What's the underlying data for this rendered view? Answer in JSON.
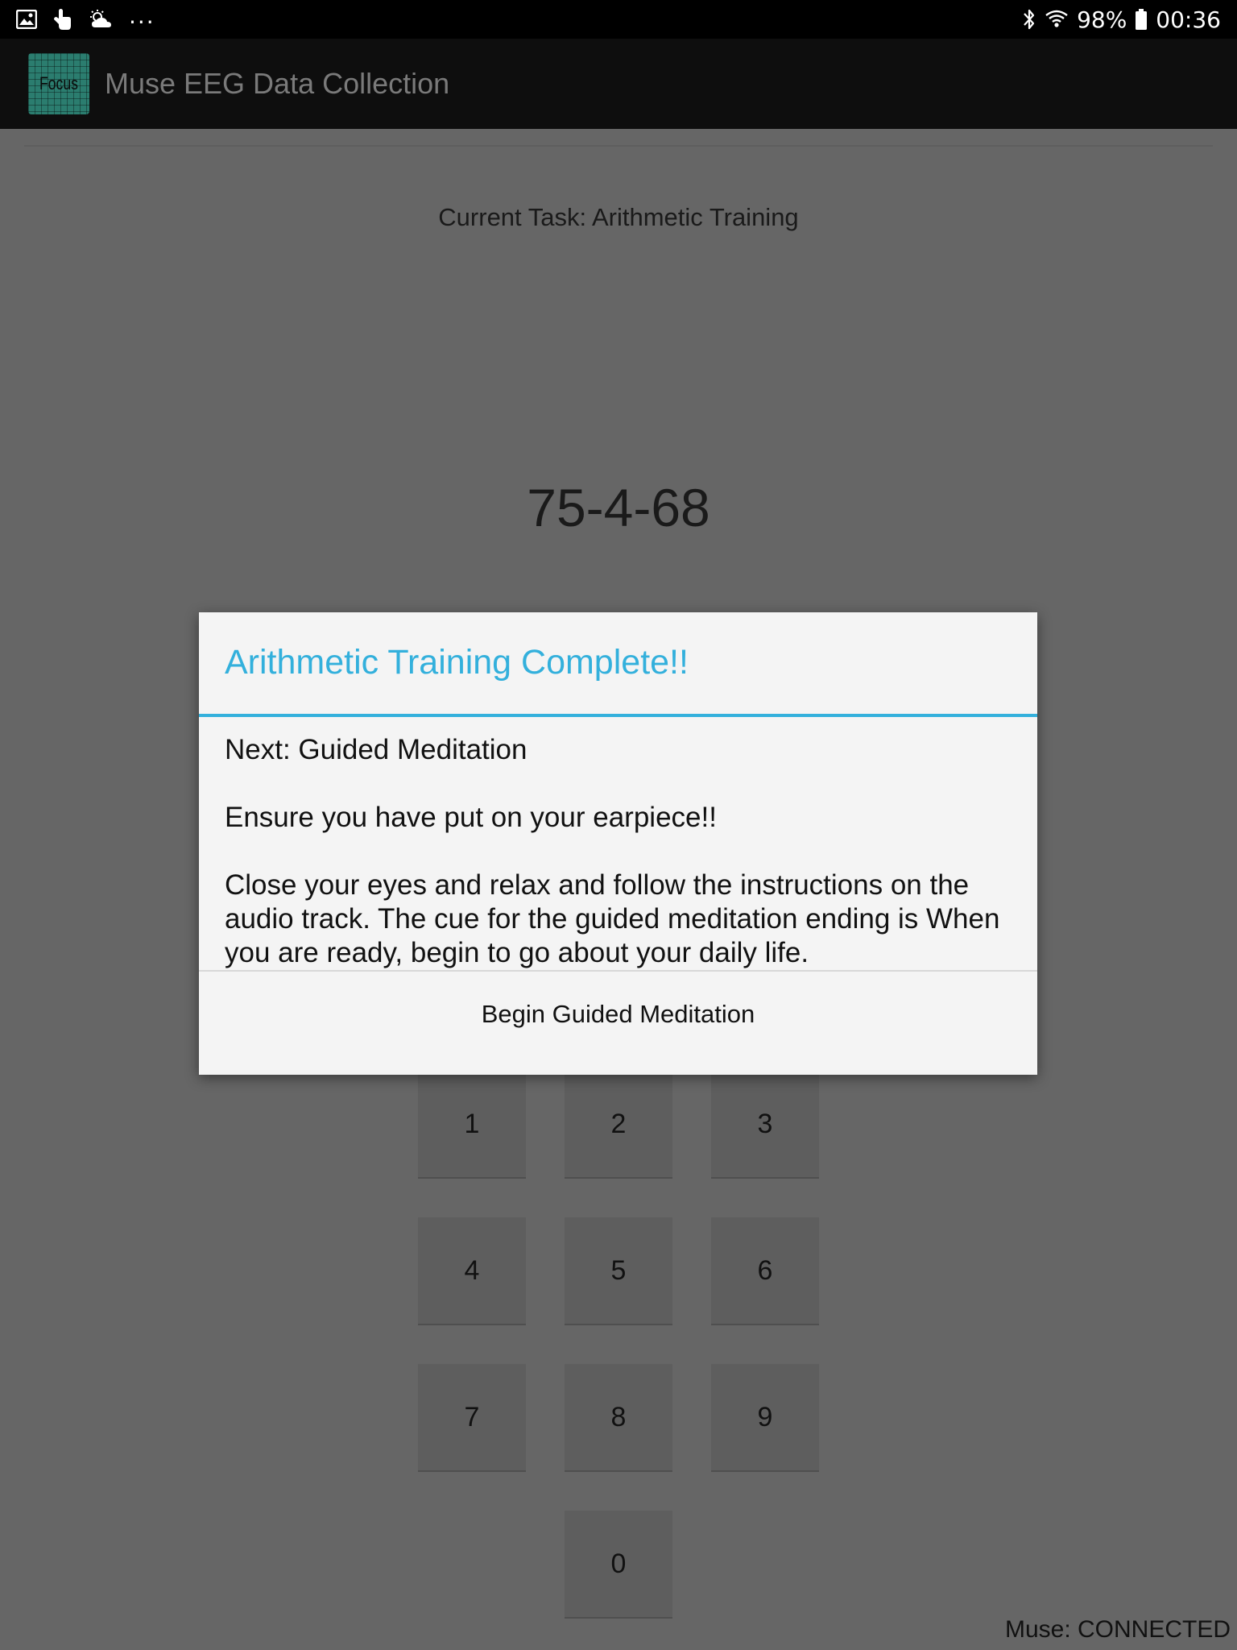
{
  "status_bar": {
    "battery": "98%",
    "time": "00:36",
    "more": "...",
    "icons": [
      "gallery-icon",
      "touch-icon",
      "weather-icon",
      "bluetooth-icon",
      "wifi-icon",
      "battery-icon"
    ]
  },
  "app_bar": {
    "logo_text": "Focus",
    "title": "Muse EEG Data Collection"
  },
  "main": {
    "current_task": "Current Task: Arithmetic Training",
    "problem": "75-4-68",
    "keypad": [
      "1",
      "2",
      "3",
      "4",
      "5",
      "6",
      "7",
      "8",
      "9",
      "0"
    ],
    "muse_status": "Muse: CONNECTED"
  },
  "dialog": {
    "title": "Arithmetic Training Complete!!",
    "next": "Next: Guided Meditation",
    "earpiece": "Ensure you have put on your earpiece!!",
    "instructions": "Close your eyes and relax and follow the instructions on the audio track. The cue for the guided meditation ending is When you are ready, begin to go about your daily life.",
    "button_label": "Begin Guided Meditation"
  },
  "colors": {
    "accent": "#33b0dc",
    "dim_background": "#666666",
    "dialog_background": "#f4f4f4"
  }
}
